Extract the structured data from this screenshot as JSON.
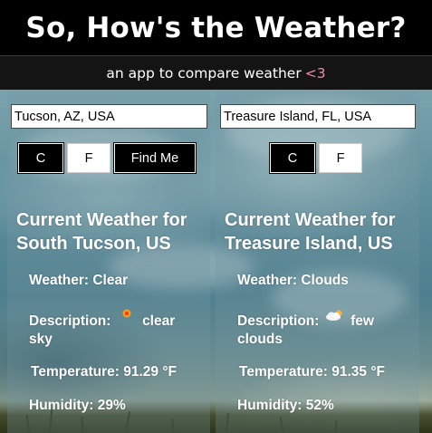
{
  "header": {
    "title": "So, How's the Weather?",
    "subtitle": "an app to compare weather",
    "heart": "<3"
  },
  "left": {
    "location_value": "Tucson, AZ, USA",
    "buttons": {
      "celsius": "C",
      "fahrenheit": "F",
      "find_me": "Find Me"
    },
    "heading_line1": "Current Weather for",
    "heading_line2": "South Tucson, US",
    "weather_label": "Weather:",
    "weather_value": "Clear",
    "description_label": "Description:",
    "description_value1": "clear",
    "description_value2": "sky",
    "description_icon": "sun-icon",
    "temperature_label": "Temperature:",
    "temperature_value": "91.29 °F",
    "humidity_label": "Humidity:",
    "humidity_value": "29%"
  },
  "right": {
    "location_value": "Treasure Island, FL, USA",
    "buttons": {
      "celsius": "C",
      "fahrenheit": "F"
    },
    "heading_line1": "Current Weather for",
    "heading_line2": "Treasure Island, US",
    "weather_label": "Weather:",
    "weather_value": "Clouds",
    "description_label": "Description:",
    "description_value1": "few",
    "description_value2": "clouds",
    "description_icon": "few-clouds-icon",
    "temperature_label": "Temperature:",
    "temperature_value": "91.35 °F",
    "humidity_label": "Humidity:",
    "humidity_value": "52%"
  },
  "colors": {
    "header_bg": "#000000",
    "subheader_bg": "#141414",
    "heart": "#f08aa8",
    "text": "#ffffff"
  }
}
